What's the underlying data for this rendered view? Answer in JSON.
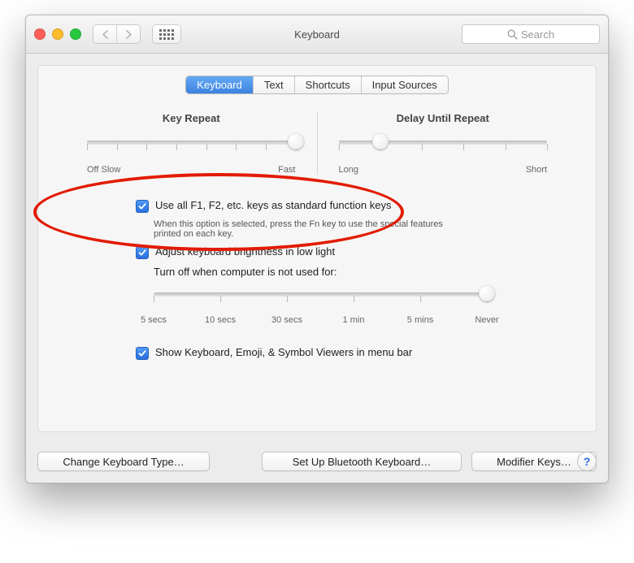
{
  "window": {
    "title": "Keyboard"
  },
  "toolbar": {
    "search_placeholder": "Search"
  },
  "tabs": [
    {
      "label": "Keyboard",
      "active": true
    },
    {
      "label": "Text",
      "active": false
    },
    {
      "label": "Shortcuts",
      "active": false
    },
    {
      "label": "Input Sources",
      "active": false
    }
  ],
  "sliders": {
    "key_repeat": {
      "title": "Key Repeat",
      "min_label": "Off Slow",
      "max_label": "Fast",
      "stops": 8,
      "value_index": 7
    },
    "delay_until_repeat": {
      "title": "Delay Until Repeat",
      "min_label": "Long",
      "max_label": "Short",
      "stops": 6,
      "value_index": 1
    }
  },
  "options": {
    "fn_keys": {
      "checked": true,
      "label": "Use all F1, F2, etc. keys as standard function keys",
      "help": "When this option is selected, press the Fn key to use the special features printed on each key."
    },
    "auto_brightness": {
      "checked": true,
      "label": "Adjust keyboard brightness in low light"
    },
    "turnoff": {
      "label": "Turn off when computer is not used for:",
      "stops_labels": [
        "5 secs",
        "10 secs",
        "30 secs",
        "1 min",
        "5 mins",
        "Never"
      ],
      "value_index": 5
    },
    "show_viewers": {
      "checked": true,
      "label": "Show Keyboard, Emoji, & Symbol Viewers in menu bar"
    }
  },
  "buttons": {
    "change_type": "Change Keyboard Type…",
    "bluetooth": "Set Up Bluetooth Keyboard…",
    "modifier": "Modifier Keys…"
  }
}
